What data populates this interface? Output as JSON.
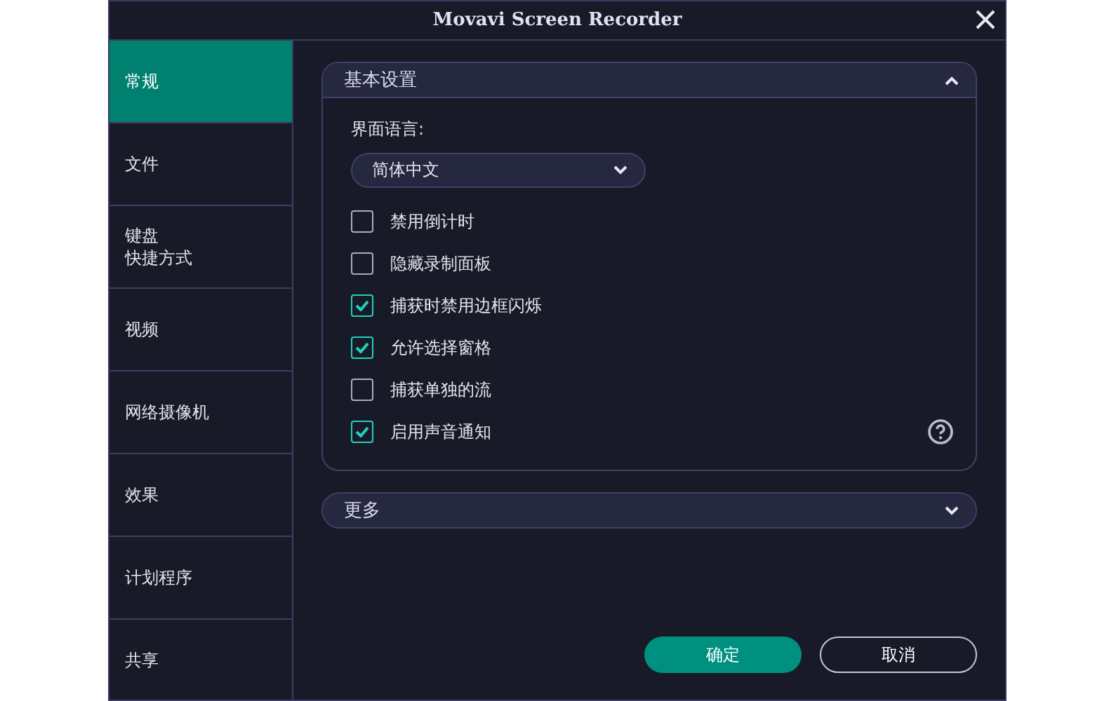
{
  "window": {
    "title": "Movavi Screen Recorder"
  },
  "sidebar": {
    "items": [
      {
        "label": "常规",
        "selected": true
      },
      {
        "label": "文件",
        "selected": false
      },
      {
        "lines": [
          "键盘",
          "快捷方式"
        ],
        "selected": false
      },
      {
        "label": "视频",
        "selected": false
      },
      {
        "label": "网络摄像机",
        "selected": false
      },
      {
        "label": "效果",
        "selected": false
      },
      {
        "label": "计划程序",
        "selected": false
      },
      {
        "label": "共享",
        "selected": false
      }
    ]
  },
  "sections": [
    {
      "title": "基本设置",
      "expanded": true,
      "language_label": "界面语言:",
      "language_value": "简体中文",
      "options": [
        {
          "label": "禁用倒计时",
          "checked": false
        },
        {
          "label": "隐藏录制面板",
          "checked": false
        },
        {
          "label": "捕获时禁用边框闪烁",
          "checked": true
        },
        {
          "label": "允许选择窗格",
          "checked": true
        },
        {
          "label": "捕获单独的流",
          "checked": false
        },
        {
          "label": "启用声音通知",
          "checked": true
        }
      ]
    },
    {
      "title": "更多",
      "expanded": false
    }
  ],
  "buttons": [
    {
      "label": "确定",
      "kind": "primary"
    },
    {
      "label": "取消",
      "kind": "secondary"
    }
  ]
}
